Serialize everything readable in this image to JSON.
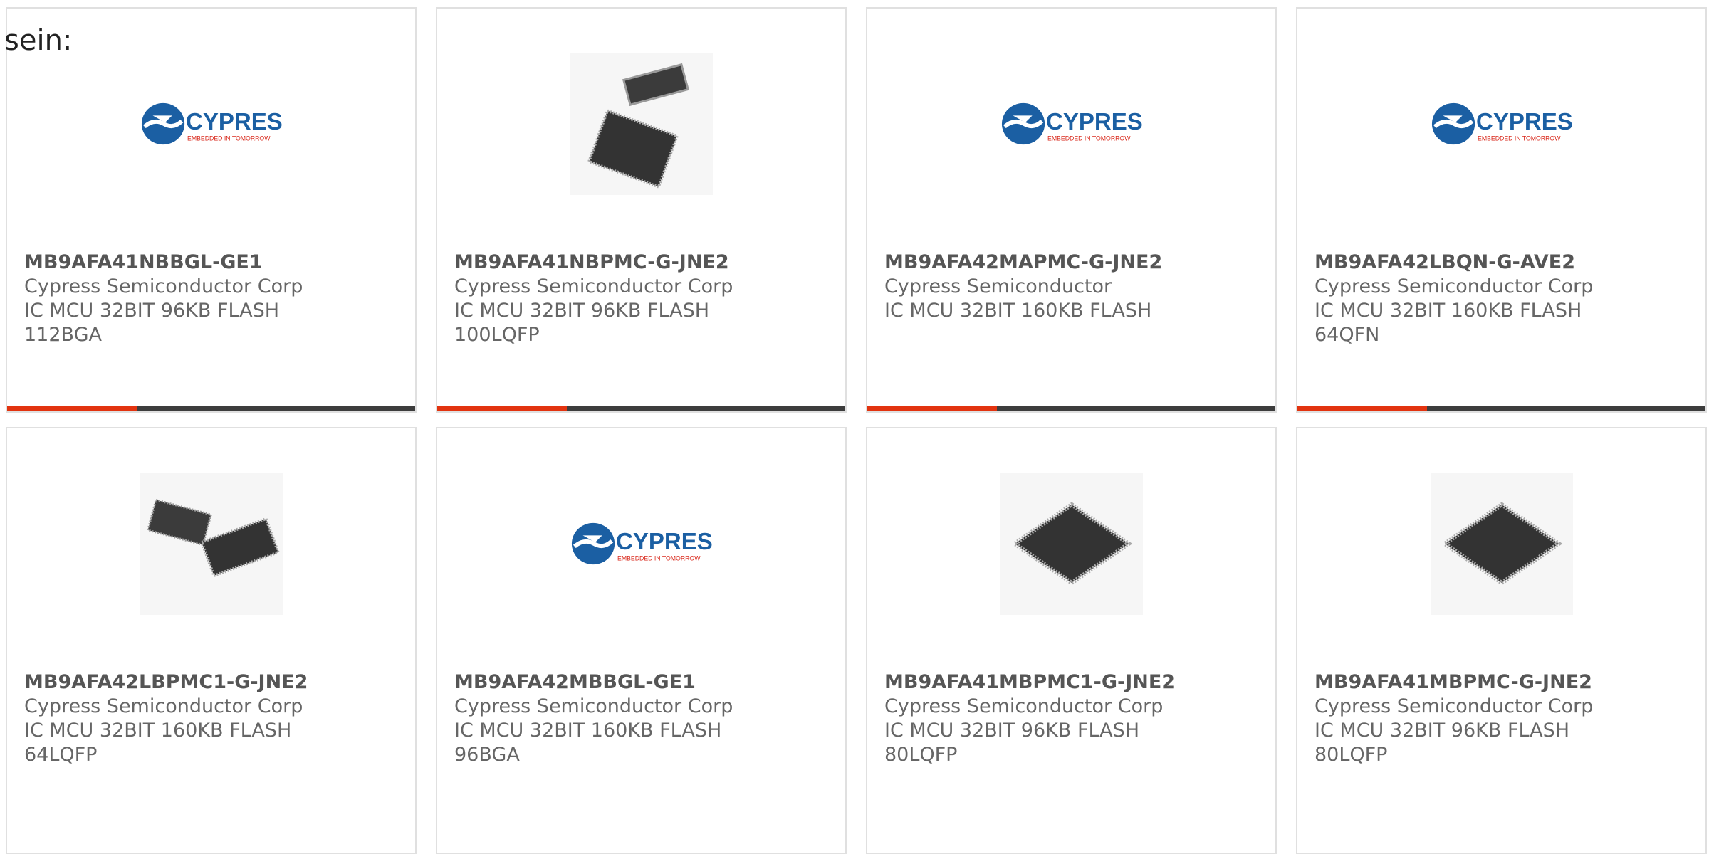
{
  "intro": "sein:",
  "cards": [
    {
      "part": "MB9AFA41NBBGL-GE1",
      "mfr": "Cypress Semiconductor Corp",
      "desc1": "IC MCU 32BIT 96KB FLASH",
      "desc2": "112BGA",
      "image": "cypress-logo",
      "logo_text": "CYPRESS",
      "logo_tag": "EMBEDDED IN TOMORROW"
    },
    {
      "part": "MB9AFA41NBPMC-G-JNE2",
      "mfr": "Cypress Semiconductor Corp",
      "desc1": "IC MCU 32BIT 96KB FLASH",
      "desc2": "100LQFP",
      "image": "two-chips-photo"
    },
    {
      "part": "MB9AFA42MAPMC-G-JNE2",
      "mfr": "Cypress Semiconductor",
      "desc1": "IC MCU 32BIT 160KB FLASH",
      "desc2": "",
      "image": "cypress-logo",
      "logo_text": "CYPRESS",
      "logo_tag": "EMBEDDED IN TOMORROW"
    },
    {
      "part": "MB9AFA42LBQN-G-AVE2",
      "mfr": "Cypress Semiconductor Corp",
      "desc1": "IC MCU 32BIT 160KB FLASH",
      "desc2": "64QFN",
      "image": "cypress-logo",
      "logo_text": "CYPRESS",
      "logo_tag": "EMBEDDED IN TOMORROW"
    },
    {
      "part": "MB9AFA42LBPMC1-G-JNE2",
      "mfr": "Cypress Semiconductor Corp",
      "desc1": "IC MCU 32BIT 160KB FLASH",
      "desc2": "64LQFP",
      "image": "two-chips-photo"
    },
    {
      "part": "MB9AFA42MBBGL-GE1",
      "mfr": "Cypress Semiconductor Corp",
      "desc1": "IC MCU 32BIT 160KB FLASH",
      "desc2": "96BGA",
      "image": "cypress-logo",
      "logo_text": "CYPRESS",
      "logo_tag": "EMBEDDED IN TOMORROW"
    },
    {
      "part": "MB9AFA41MBPMC1-G-JNE2",
      "mfr": "Cypress Semiconductor Corp",
      "desc1": "IC MCU 32BIT 96KB FLASH",
      "desc2": "80LQFP",
      "image": "single-chip-photo"
    },
    {
      "part": "MB9AFA41MBPMC-G-JNE2",
      "mfr": "Cypress Semiconductor Corp",
      "desc1": "IC MCU 32BIT 96KB FLASH",
      "desc2": "80LQFP",
      "image": "single-chip-photo"
    }
  ],
  "colors": {
    "accent_red": "#e2330f",
    "accent_dark": "#3d3d3d",
    "logo_blue": "#1b5fa3",
    "logo_red": "#d9291c"
  }
}
